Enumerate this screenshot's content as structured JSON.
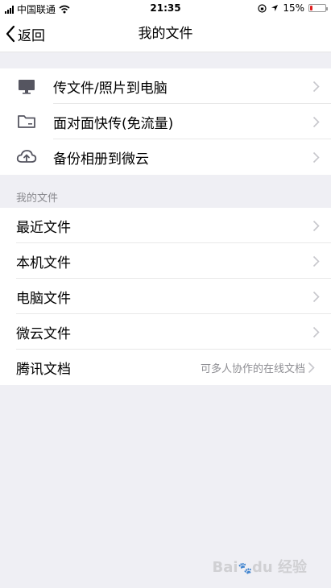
{
  "status_bar": {
    "carrier": "中国联通",
    "time": "21:35",
    "battery": "15%",
    "battery_level": 0.15
  },
  "nav": {
    "back_label": "返回",
    "title": "我的文件"
  },
  "transfer_items": [
    {
      "label": "传文件/照片到电脑",
      "icon": "monitor-icon"
    },
    {
      "label": "面对面快传(免流量)",
      "icon": "folder-icon"
    },
    {
      "label": "备份相册到微云",
      "icon": "cloud-upload-icon"
    }
  ],
  "files_section": {
    "header": "我的文件",
    "items": [
      {
        "label": "最近文件",
        "sub": ""
      },
      {
        "label": "本机文件",
        "sub": ""
      },
      {
        "label": "电脑文件",
        "sub": ""
      },
      {
        "label": "微云文件",
        "sub": ""
      },
      {
        "label": "腾讯文档",
        "sub": "可多人协作的在线文档"
      }
    ]
  },
  "watermark": "Bai du 经验",
  "colors": {
    "background": "#efeff4",
    "icon": "#555560",
    "chevron": "#c7c7cc",
    "battery_low": "#e02020"
  }
}
